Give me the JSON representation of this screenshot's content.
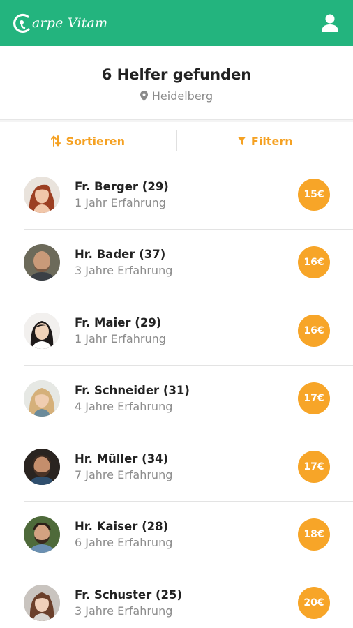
{
  "header": {
    "logo_text": "arpe Vitam",
    "brand_color": "#23b47e",
    "user_icon": "user-icon"
  },
  "summary": {
    "title": "6 Helfer gefunden",
    "location": "Heidelberg"
  },
  "toolbar": {
    "sort_label": "Sortieren",
    "filter_label": "Filtern",
    "accent_color": "#f5a122"
  },
  "helpers": [
    {
      "name": "Fr. Berger (29)",
      "experience": "1 Jahr Erfahrung",
      "price": "15€",
      "avatar": "woman-red-hair"
    },
    {
      "name": "Hr. Bader (37)",
      "experience": "3 Jahre Erfahrung",
      "price": "16€",
      "avatar": "man-bald"
    },
    {
      "name": "Fr. Maier (29)",
      "experience": "1 Jahr Erfahrung",
      "price": "16€",
      "avatar": "woman-dark-hair"
    },
    {
      "name": "Fr. Schneider (31)",
      "experience": "4 Jahre Erfahrung",
      "price": "17€",
      "avatar": "woman-blonde"
    },
    {
      "name": "Hr. Müller (34)",
      "experience": "7 Jahre Erfahrung",
      "price": "17€",
      "avatar": "man-beard-dark"
    },
    {
      "name": "Hr. Kaiser (28)",
      "experience": "6 Jahre Erfahrung",
      "price": "18€",
      "avatar": "man-beard-outdoor"
    },
    {
      "name": "Fr. Schuster  (25)",
      "experience": "3 Jahre Erfahrung",
      "price": "20€",
      "avatar": "woman-brown-hair"
    }
  ]
}
